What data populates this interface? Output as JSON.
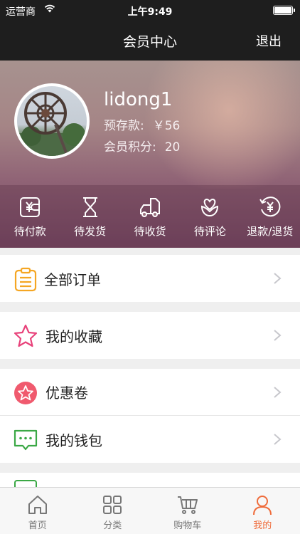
{
  "status_bar": {
    "carrier": "运营商",
    "time": "上午9:49"
  },
  "nav": {
    "title": "会员中心",
    "logout": "退出"
  },
  "profile": {
    "username": "lidong1",
    "deposit_label": "预存款:",
    "deposit_value": "￥56",
    "points_label": "会员积分:",
    "points_value": "20"
  },
  "order_status": [
    {
      "label": "待付款",
      "icon": "wallet-yen-icon"
    },
    {
      "label": "待发货",
      "icon": "hourglass-icon"
    },
    {
      "label": "待收货",
      "icon": "truck-icon"
    },
    {
      "label": "待评论",
      "icon": "heart-flower-icon"
    },
    {
      "label": "退款/退货",
      "icon": "refund-yen-icon"
    }
  ],
  "menu": [
    {
      "label": "全部订单",
      "icon": "clipboard-list-icon",
      "color": "#f5a623"
    },
    {
      "label": "我的收藏",
      "icon": "star-outline-icon",
      "color": "#e8427a"
    },
    {
      "label": "优惠卷",
      "icon": "star-circle-icon",
      "color": "#f05a6e"
    },
    {
      "label": "我的钱包",
      "icon": "chat-wallet-icon",
      "color": "#3aa845"
    }
  ],
  "tabs": [
    {
      "label": "首页",
      "icon": "home-icon",
      "active": false
    },
    {
      "label": "分类",
      "icon": "grid-icon",
      "active": false
    },
    {
      "label": "购物车",
      "icon": "cart-icon",
      "active": false
    },
    {
      "label": "我的",
      "icon": "person-icon",
      "active": true
    }
  ],
  "colors": {
    "accent": "#ef6b3a",
    "topbar": "#1e1e1e"
  }
}
